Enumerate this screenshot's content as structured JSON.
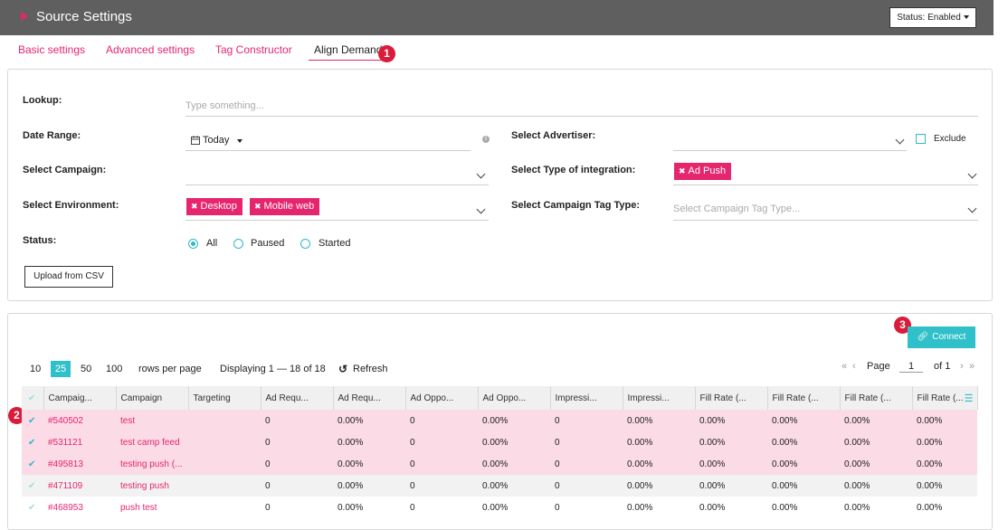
{
  "header": {
    "title": "Source Settings",
    "status_button": "Status: Enabled"
  },
  "tabs": [
    "Basic settings",
    "Advanced settings",
    "Tag Constructor",
    "Align Demand"
  ],
  "badges": [
    "1",
    "2",
    "3"
  ],
  "filters": {
    "lookup_label": "Lookup:",
    "lookup_placeholder": "Type something...",
    "date_range_label": "Date Range:",
    "date_range_value": "Today",
    "advertiser_label": "Select Advertiser:",
    "exclude_label": "Exclude",
    "campaign_label": "Select Campaign:",
    "integration_label": "Select Type of integration:",
    "integration_chip": "Ad Push",
    "environment_label": "Select Environment:",
    "environment_chips": [
      "Desktop",
      "Mobile web"
    ],
    "tag_type_label": "Select Campaign Tag Type:",
    "tag_type_placeholder": "Select Campaign Tag Type...",
    "status_label": "Status:",
    "status_options": [
      "All",
      "Paused",
      "Started"
    ],
    "status_selected": "All",
    "upload_button": "Upload from CSV"
  },
  "results": {
    "connect_button": "Connect",
    "page_sizes": [
      "10",
      "25",
      "50",
      "100"
    ],
    "page_size_active": "25",
    "rows_per_page_label": "rows per page",
    "displaying": "Displaying 1 — 18 of 18",
    "refresh_label": "Refresh",
    "page_label": "Page",
    "page_value": "1",
    "of_label": "of 1",
    "columns": [
      "Campaig...",
      "Campaign",
      "Targeting",
      "Ad Requ...",
      "Ad Requ...",
      "Ad Oppo...",
      "Ad Oppo...",
      "Impressi...",
      "Impressi...",
      "Fill Rate (...",
      "Fill Rate (...",
      "Fill Rate (...",
      "Fill Rate (..."
    ],
    "rows": [
      {
        "id": "#540502",
        "campaign": "test",
        "targeting": "",
        "v": [
          "0",
          "0.00%",
          "0",
          "0.00%",
          "0",
          "0.00%",
          "0.00%",
          "0.00%",
          "0.00%",
          "0.00%"
        ],
        "selected": true
      },
      {
        "id": "#531121",
        "campaign": "test camp feed",
        "targeting": "",
        "v": [
          "0",
          "0.00%",
          "0",
          "0.00%",
          "0",
          "0.00%",
          "0.00%",
          "0.00%",
          "0.00%",
          "0.00%"
        ],
        "selected": true
      },
      {
        "id": "#495813",
        "campaign": "testing push (...",
        "targeting": "",
        "v": [
          "0",
          "0.00%",
          "0",
          "0.00%",
          "0",
          "0.00%",
          "0.00%",
          "0.00%",
          "0.00%",
          "0.00%"
        ],
        "selected": true
      },
      {
        "id": "#471109",
        "campaign": "testing push",
        "targeting": "",
        "v": [
          "0",
          "0.00%",
          "0",
          "0.00%",
          "0",
          "0.00%",
          "0.00%",
          "0.00%",
          "0.00%",
          "0.00%"
        ],
        "selected": false
      },
      {
        "id": "#468953",
        "campaign": "push test",
        "targeting": "",
        "v": [
          "0",
          "0.00%",
          "0",
          "0.00%",
          "0",
          "0.00%",
          "0.00%",
          "0.00%",
          "0.00%",
          "0.00%"
        ],
        "selected": false
      }
    ]
  },
  "colors": {
    "accent": "#e6256f",
    "teal": "#2fc0c9",
    "badge": "#d81c3a",
    "header_bg": "#5f5f5f",
    "selected_row": "#fbdbe6"
  }
}
